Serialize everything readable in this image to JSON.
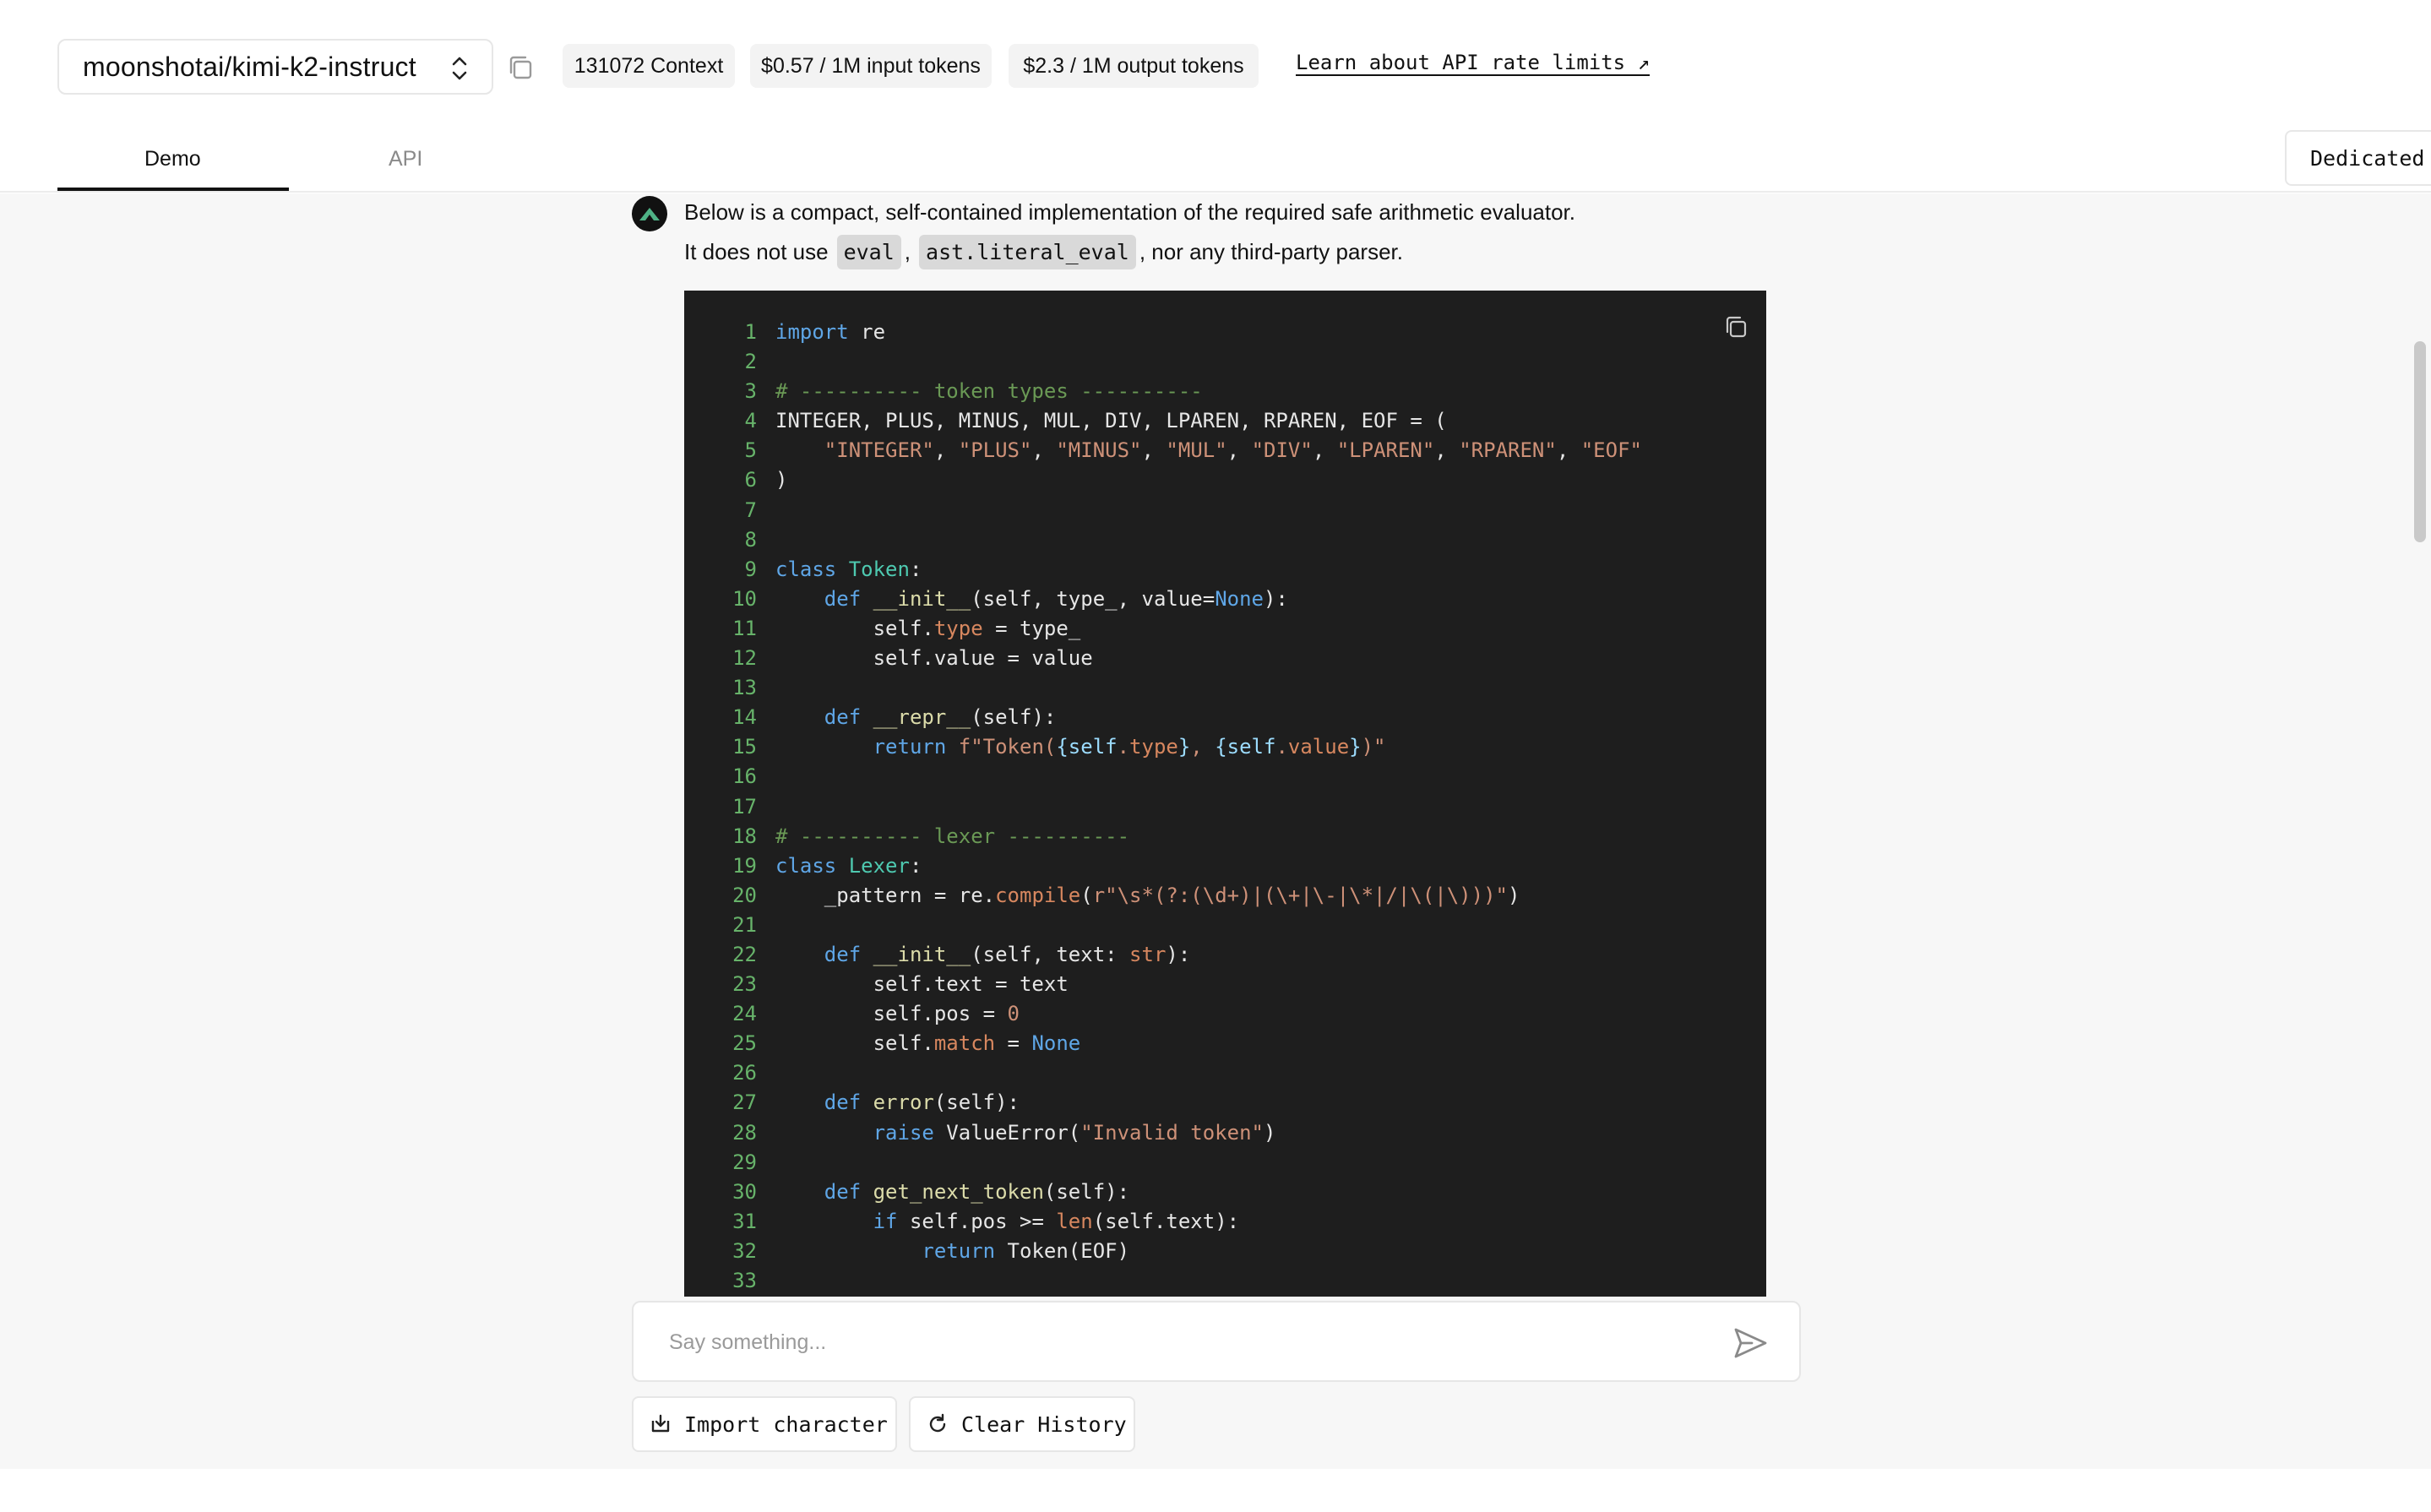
{
  "header": {
    "model_name": "moonshotai/kimi-k2-instruct",
    "context_chip": "131072 Context",
    "input_chip": "$0.57 / 1M input tokens",
    "output_chip": "$2.3 / 1M output tokens",
    "rate_limits_link": "Learn about API rate limits ↗"
  },
  "tabs": {
    "demo": "Demo",
    "api": "API",
    "dedicated": "Dedicated"
  },
  "message": {
    "line1": "Below is a compact, self-contained implementation of the required safe arithmetic evaluator.",
    "line2_prefix": "It does not use",
    "code1": "eval",
    "sep": ",",
    "code2": "ast.literal_eval",
    "line2_suffix": ", nor any third-party parser."
  },
  "code": {
    "language": "python",
    "lines": [
      "import re",
      "",
      "# ---------- token types ----------",
      "INTEGER, PLUS, MINUS, MUL, DIV, LPAREN, RPAREN, EOF = (",
      "    \"INTEGER\", \"PLUS\", \"MINUS\", \"MUL\", \"DIV\", \"LPAREN\", \"RPAREN\", \"EOF\"",
      ")",
      "",
      "",
      "class Token:",
      "    def __init__(self, type_, value=None):",
      "        self.type = type_",
      "        self.value = value",
      "",
      "    def __repr__(self):",
      "        return f\"Token({self.type}, {self.value})\"",
      "",
      "",
      "# ---------- lexer ----------",
      "class Lexer:",
      "    _pattern = re.compile(r\"\\s*(?:(\\d+)|(\\+|\\-|\\*|/|\\(|\\)))\")",
      "",
      "    def __init__(self, text: str):",
      "        self.text = text",
      "        self.pos = 0",
      "        self.match = None",
      "",
      "    def error(self):",
      "        raise ValueError(\"Invalid token\")",
      "",
      "    def get_next_token(self):",
      "        if self.pos >= len(self.text):",
      "            return Token(EOF)",
      ""
    ]
  },
  "composer": {
    "placeholder": "Say something...",
    "import_label": "Import character",
    "clear_label": "Clear History"
  }
}
